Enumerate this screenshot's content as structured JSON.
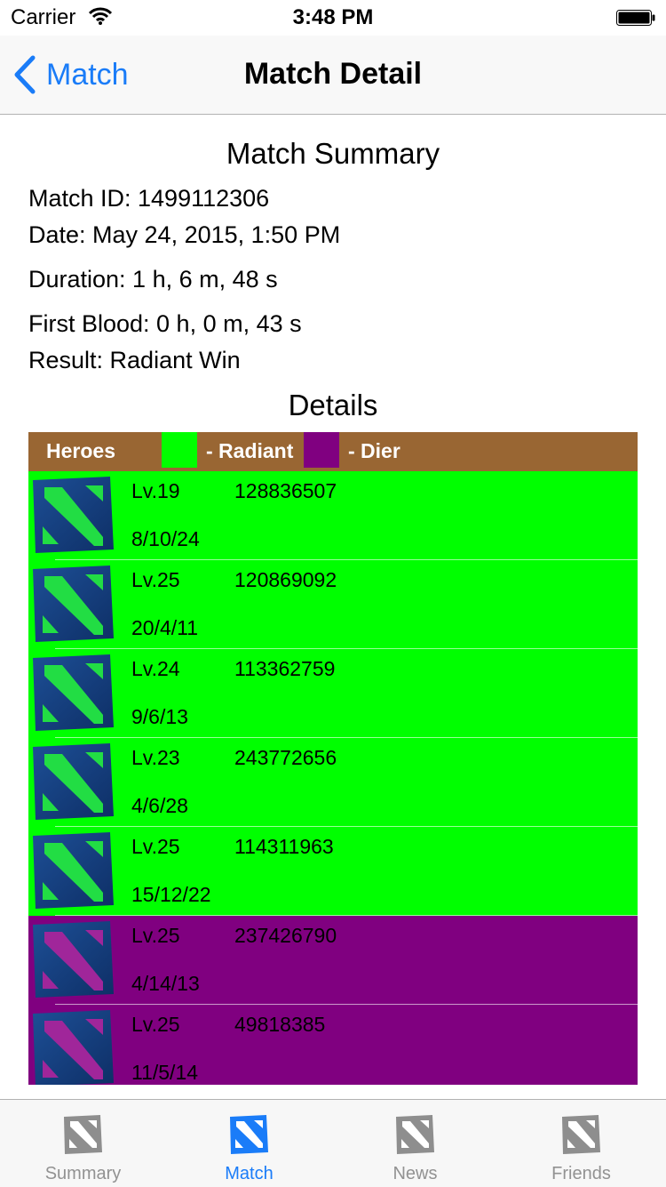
{
  "status_bar": {
    "carrier": "Carrier",
    "time": "3:48 PM"
  },
  "nav": {
    "back_label": "Match",
    "title": "Match Detail"
  },
  "summary": {
    "heading": "Match Summary",
    "match_id": "Match ID: 1499112306",
    "date": "Date: May 24, 2015, 1:50 PM",
    "duration": "Duration: 1 h, 6 m, 48 s",
    "first_blood": "First Blood: 0 h, 0 m, 43 s",
    "result": "Result: Radiant Win"
  },
  "details": {
    "heading": "Details",
    "header": {
      "heroes": "Heroes",
      "radiant": "- Radiant",
      "dier": "- Dier"
    },
    "colors": {
      "radiant": "#00ff00",
      "dier": "#800080",
      "header_bg": "#996633"
    },
    "rows": [
      {
        "team": "radiant",
        "level": "Lv.19",
        "account": "128836507",
        "kda": "8/10/24"
      },
      {
        "team": "radiant",
        "level": "Lv.25",
        "account": "120869092",
        "kda": "20/4/11"
      },
      {
        "team": "radiant",
        "level": "Lv.24",
        "account": "113362759",
        "kda": "9/6/13"
      },
      {
        "team": "radiant",
        "level": "Lv.23",
        "account": "243772656",
        "kda": "4/6/28"
      },
      {
        "team": "radiant",
        "level": "Lv.25",
        "account": "114311963",
        "kda": "15/12/22"
      },
      {
        "team": "dier",
        "level": "Lv.25",
        "account": "237426790",
        "kda": "4/14/13"
      },
      {
        "team": "dier",
        "level": "Lv.25",
        "account": "49818385",
        "kda": "11/5/14"
      }
    ]
  },
  "tabs": [
    {
      "label": "Summary",
      "icon": "dota-logo-icon",
      "active": false
    },
    {
      "label": "Match",
      "icon": "dota-logo-icon",
      "active": true
    },
    {
      "label": "News",
      "icon": "dota-logo-icon",
      "active": false
    },
    {
      "label": "Friends",
      "icon": "dota-logo-icon",
      "active": false
    }
  ],
  "accent_color": "#1a7cf8"
}
